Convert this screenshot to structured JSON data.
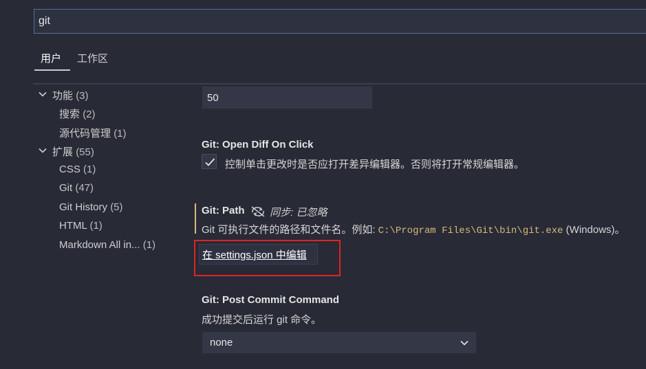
{
  "search": {
    "value": "git"
  },
  "tabs": [
    {
      "label": "用户"
    },
    {
      "label": "工作区"
    }
  ],
  "tree": [
    {
      "label": "功能",
      "count": "(3)"
    },
    {
      "label": "搜索",
      "count": "(2)"
    },
    {
      "label": "源代码管理",
      "count": "(1)"
    },
    {
      "label": "扩展",
      "count": "(55)"
    },
    {
      "label": "CSS",
      "count": "(1)"
    },
    {
      "label": "Git",
      "count": "(47)"
    },
    {
      "label": "Git History",
      "count": "(5)"
    },
    {
      "label": "HTML",
      "count": "(1)"
    },
    {
      "label": "Markdown All in...",
      "count": "(1)"
    }
  ],
  "settings": {
    "number_value": "50",
    "open_diff": {
      "title": "Git: Open Diff On Click",
      "description": "控制单击更改时是否应打开差异编辑器。否则将打开常规编辑器。",
      "checked": true
    },
    "path": {
      "title": "Git: Path",
      "sync_label": "同步: 已忽略",
      "description_prefix": "Git 可执行文件的路径和文件名。例如: ",
      "example_path": "C:\\Program Files\\Git\\bin\\git.exe",
      "description_suffix": " (Windows)。",
      "edit_link": "在 settings.json 中编辑"
    },
    "post_commit": {
      "title": "Git: Post Commit Command",
      "description": "成功提交后运行 git 命令。",
      "selected": "none"
    }
  },
  "colors": {
    "background": "#282a36",
    "modified_indicator": "#d7ba7d",
    "highlight_box": "#e02424"
  },
  "icons": {
    "expand": "chevron-down-icon",
    "check": "check-icon",
    "sync_ignored": "sync-ignored-icon",
    "dropdown": "chevron-down-icon"
  }
}
